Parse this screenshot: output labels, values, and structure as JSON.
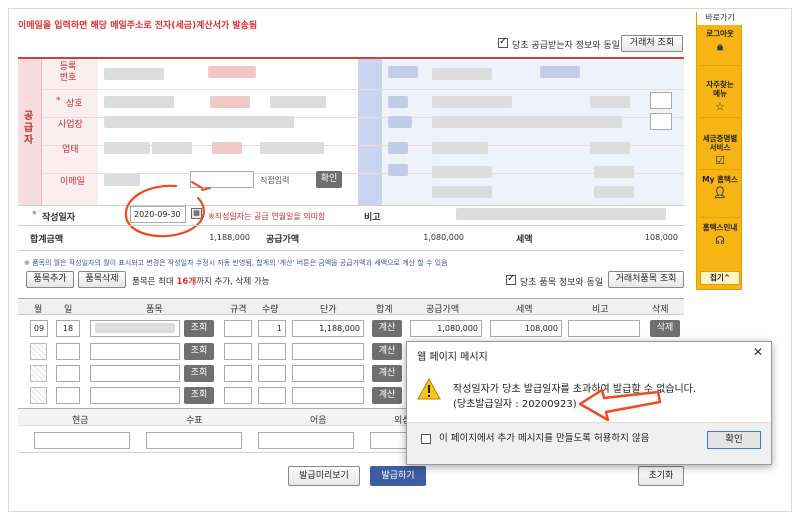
{
  "notice": "이메일을 입력하면 해당 메일주소로 전자(세금)계산서가 발송됨",
  "same_receiver_label": "당초 공급받는자 정보와 동일",
  "partner_lookup_btn": "거래처 조회",
  "supplier": {
    "side_label": "공급자",
    "reg_no_label": "등록\n번호",
    "name_label": "상호",
    "address_label": "사업장",
    "business_label": "업태",
    "email_label": "이메일",
    "email_confirm": "확인"
  },
  "date": {
    "label": "작성일자",
    "value": "2020-09-30",
    "hint": "※작성일자는 공급 연월일을 의미함",
    "note_label": "비고"
  },
  "totals": {
    "total_label": "합계금액",
    "total_value": "1,188,000",
    "supply_label": "공급가액",
    "supply_value": "1,080,000",
    "tax_label": "세액",
    "tax_value": "108,000"
  },
  "item_notice": "※ 품목의 월은 작성일자의 월이 표시되고 변경은 작성일자 수정시 자동 반영됨, 합계의 '계산' 버튼은 금액을 공급가액과 세액으로 계산 할 수 있음",
  "item_toolbar": {
    "add": "품목추가",
    "delete": "품목삭제",
    "max_pre": "품목은 최대",
    "max_count": "16개",
    "max_post": "까지 추가, 삭제 가능",
    "same_item_label": "당초 품목 정보와 동일",
    "partner_item_btn": "거래처품목 조회"
  },
  "item_headers": [
    "월",
    "일",
    "품목",
    "규격",
    "수량",
    "단가",
    "합계",
    "공급가액",
    "세액",
    "비고",
    "삭제"
  ],
  "item_rows": [
    {
      "month": "09",
      "day": "18",
      "lookup": "조회",
      "qty": "1",
      "price": "1,188,000",
      "calc": "계산",
      "supply": "1,080,000",
      "tax": "108,000",
      "del": "삭제"
    },
    {
      "month": "",
      "day": "",
      "lookup": "조회",
      "qty": "",
      "price": "",
      "calc": "계산",
      "supply": "",
      "tax": "",
      "del": ""
    },
    {
      "month": "",
      "day": "",
      "lookup": "조회",
      "qty": "",
      "price": "",
      "calc": "계산",
      "supply": "",
      "tax": "",
      "del": ""
    },
    {
      "month": "",
      "day": "",
      "lookup": "조회",
      "qty": "",
      "price": "",
      "calc": "계산",
      "supply": "",
      "tax": "",
      "del": ""
    }
  ],
  "payment_headers": [
    "현금",
    "수표",
    "어음",
    "외상"
  ],
  "bottom_buttons": {
    "preview": "발급미리보기",
    "issue": "발급하기",
    "reset": "초기화"
  },
  "sidebar": {
    "title": "바로가기",
    "items": [
      {
        "label": "로그아웃",
        "icon": "lock-icon"
      },
      {
        "label": "자주찾는\n메뉴",
        "icon": "star-icon"
      },
      {
        "label": "세금증명별\n서비스",
        "icon": "checkbox-icon"
      },
      {
        "label": "My 홈택스",
        "icon": "person-icon"
      },
      {
        "label": "홈택스인내",
        "icon": "headset-icon"
      }
    ],
    "collapse": "접기^"
  },
  "dialog": {
    "title": "웹 페이지 메시지",
    "line1": "작성일자가 당초 발급일자를 초과하여 발급할 수 없습니다.",
    "line2": "(당초발급일자 : 20200923)",
    "suppress": "이 페이지에서 추가 메시지를 만들도록 허용하지 않음",
    "ok": "확인"
  },
  "colors": {
    "accent_red": "#e03030",
    "sidebar_yellow": "#f7b515",
    "issue_blue": "#3e5ea3",
    "annotation_orange": "#f04a1e"
  }
}
